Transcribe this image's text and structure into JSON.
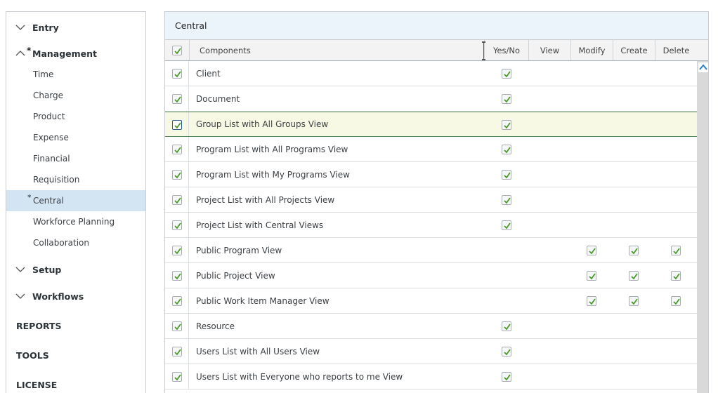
{
  "sidebar": {
    "groups": [
      {
        "label": "Entry",
        "expanded": false,
        "modified": false
      },
      {
        "label": "Management",
        "expanded": true,
        "modified": true
      },
      {
        "label": "Setup",
        "expanded": false,
        "modified": false
      },
      {
        "label": "Workflows",
        "expanded": false,
        "modified": false
      }
    ],
    "management_items": [
      {
        "label": "Time"
      },
      {
        "label": "Charge"
      },
      {
        "label": "Product"
      },
      {
        "label": "Expense"
      },
      {
        "label": "Financial"
      },
      {
        "label": "Requisition"
      },
      {
        "label": "Central",
        "active": true,
        "modified_marker": "*"
      },
      {
        "label": "Workforce Planning"
      },
      {
        "label": "Collaboration"
      }
    ],
    "modified_marker": "*",
    "top_links": [
      "REPORTS",
      "TOOLS",
      "LICENSE"
    ]
  },
  "panel": {
    "title": "Central",
    "columns": {
      "components": "Components",
      "yes_no": "Yes/No",
      "view": "View",
      "modify": "Modify",
      "create": "Create",
      "delete": "Delete"
    },
    "header_checkbox_checked": true,
    "rows": [
      {
        "name": "Client",
        "selected": false,
        "yes_no": true,
        "modify": false,
        "create": false,
        "delete": false
      },
      {
        "name": "Document",
        "selected": false,
        "yes_no": true,
        "modify": false,
        "create": false,
        "delete": false
      },
      {
        "name": "Group List with All Groups View",
        "selected": true,
        "yes_no": true,
        "modify": false,
        "create": false,
        "delete": false
      },
      {
        "name": "Program List with All Programs View",
        "selected": false,
        "yes_no": true,
        "modify": false,
        "create": false,
        "delete": false
      },
      {
        "name": "Program List with My Programs View",
        "selected": false,
        "yes_no": true,
        "modify": false,
        "create": false,
        "delete": false
      },
      {
        "name": "Project List with All Projects View",
        "selected": false,
        "yes_no": true,
        "modify": false,
        "create": false,
        "delete": false
      },
      {
        "name": "Project List with Central Views",
        "selected": false,
        "yes_no": true,
        "modify": false,
        "create": false,
        "delete": false
      },
      {
        "name": "Public Program View",
        "selected": false,
        "yes_no": false,
        "modify": true,
        "create": true,
        "delete": true
      },
      {
        "name": "Public Project View",
        "selected": false,
        "yes_no": false,
        "modify": true,
        "create": true,
        "delete": true
      },
      {
        "name": "Public Work Item Manager View",
        "selected": false,
        "yes_no": false,
        "modify": true,
        "create": true,
        "delete": true
      },
      {
        "name": "Resource",
        "selected": false,
        "yes_no": true,
        "modify": false,
        "create": false,
        "delete": false
      },
      {
        "name": "Users List with All Users View",
        "selected": false,
        "yes_no": true,
        "modify": false,
        "create": false,
        "delete": false
      },
      {
        "name": "Users List with Everyone who reports to me View",
        "selected": false,
        "yes_no": true,
        "modify": false,
        "create": false,
        "delete": false
      }
    ]
  },
  "colors": {
    "check_green": "#4a9a2a",
    "active_item_bg": "#d3e4f3",
    "header_bg": "#ebf4fb",
    "selected_row_bg": "#f8f9e4",
    "scroll_arrow": "#2a7fc8"
  }
}
